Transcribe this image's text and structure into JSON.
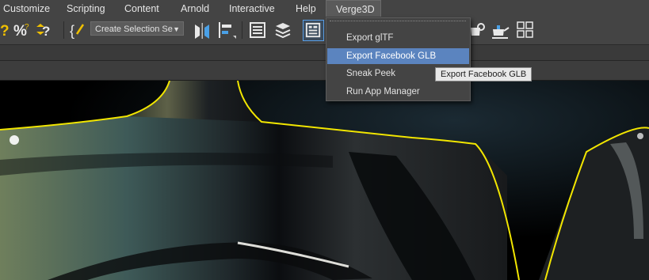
{
  "menubar": {
    "items": [
      {
        "label": "Customize"
      },
      {
        "label": "Scripting"
      },
      {
        "label": "Content"
      },
      {
        "label": "Arnold"
      },
      {
        "label": "Interactive"
      },
      {
        "label": "Help"
      },
      {
        "label": "Verge3D"
      }
    ]
  },
  "toolbar": {
    "selection_set": "Create Selection Se",
    "icons": [
      "percent-snap-icon",
      "spinner-snap-icon",
      "edit-named-selection-icon",
      "mirror-icon",
      "align-icon",
      "scene-explorer-icon",
      "layer-explorer-icon",
      "toggle-ribbon-icon",
      "render-setup-icon",
      "render-frame-icon",
      "render-icon"
    ]
  },
  "verge3d_menu": {
    "items": [
      {
        "label": "Export glTF"
      },
      {
        "label": "Export Facebook GLB",
        "highlighted": true
      },
      {
        "label": "Sneak Peek"
      },
      {
        "label": "Run App Manager"
      }
    ]
  },
  "tooltip": {
    "text": "Export Facebook GLB"
  },
  "colors": {
    "menubar_bg": "#444444",
    "highlight": "#5b84bf",
    "selection_outline": "#f2e600",
    "viewport_bg": "#000000"
  }
}
